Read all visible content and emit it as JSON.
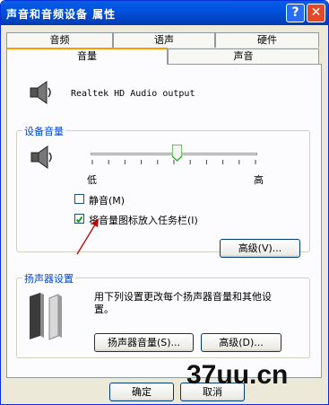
{
  "window": {
    "title": "声音和音频设备 属性",
    "help_glyph": "?",
    "close_glyph": "✕"
  },
  "tabs_row1": [
    "音频",
    "语声",
    "硬件"
  ],
  "tabs_row2": [
    "音量",
    "声音"
  ],
  "device": {
    "name": "Realtek HD Audio output"
  },
  "device_volume": {
    "title": "设备音量",
    "low": "低",
    "high": "高",
    "slider_level": 0.52,
    "mute_label": "静音(M)",
    "mute_checked": false,
    "tray_label": "将音量图标放入任务栏(I)",
    "tray_checked": true,
    "advanced_label": "高级(V)..."
  },
  "speaker": {
    "title": "扬声器设置",
    "desc_line1": "用下列设置更改每个扬声器音量和其他设",
    "desc_line2": "置。",
    "speaker_volume_label": "扬声器音量(S)...",
    "advanced_label": "高级(D)..."
  },
  "footer": {
    "ok_label": "确定",
    "cancel_label": "取消"
  },
  "watermark": "37uu.cn",
  "colors": {
    "title_bar": "#0054e3",
    "tab_highlight": "#ff9900",
    "group_label": "#0046d5",
    "arrow": "#c00000"
  }
}
